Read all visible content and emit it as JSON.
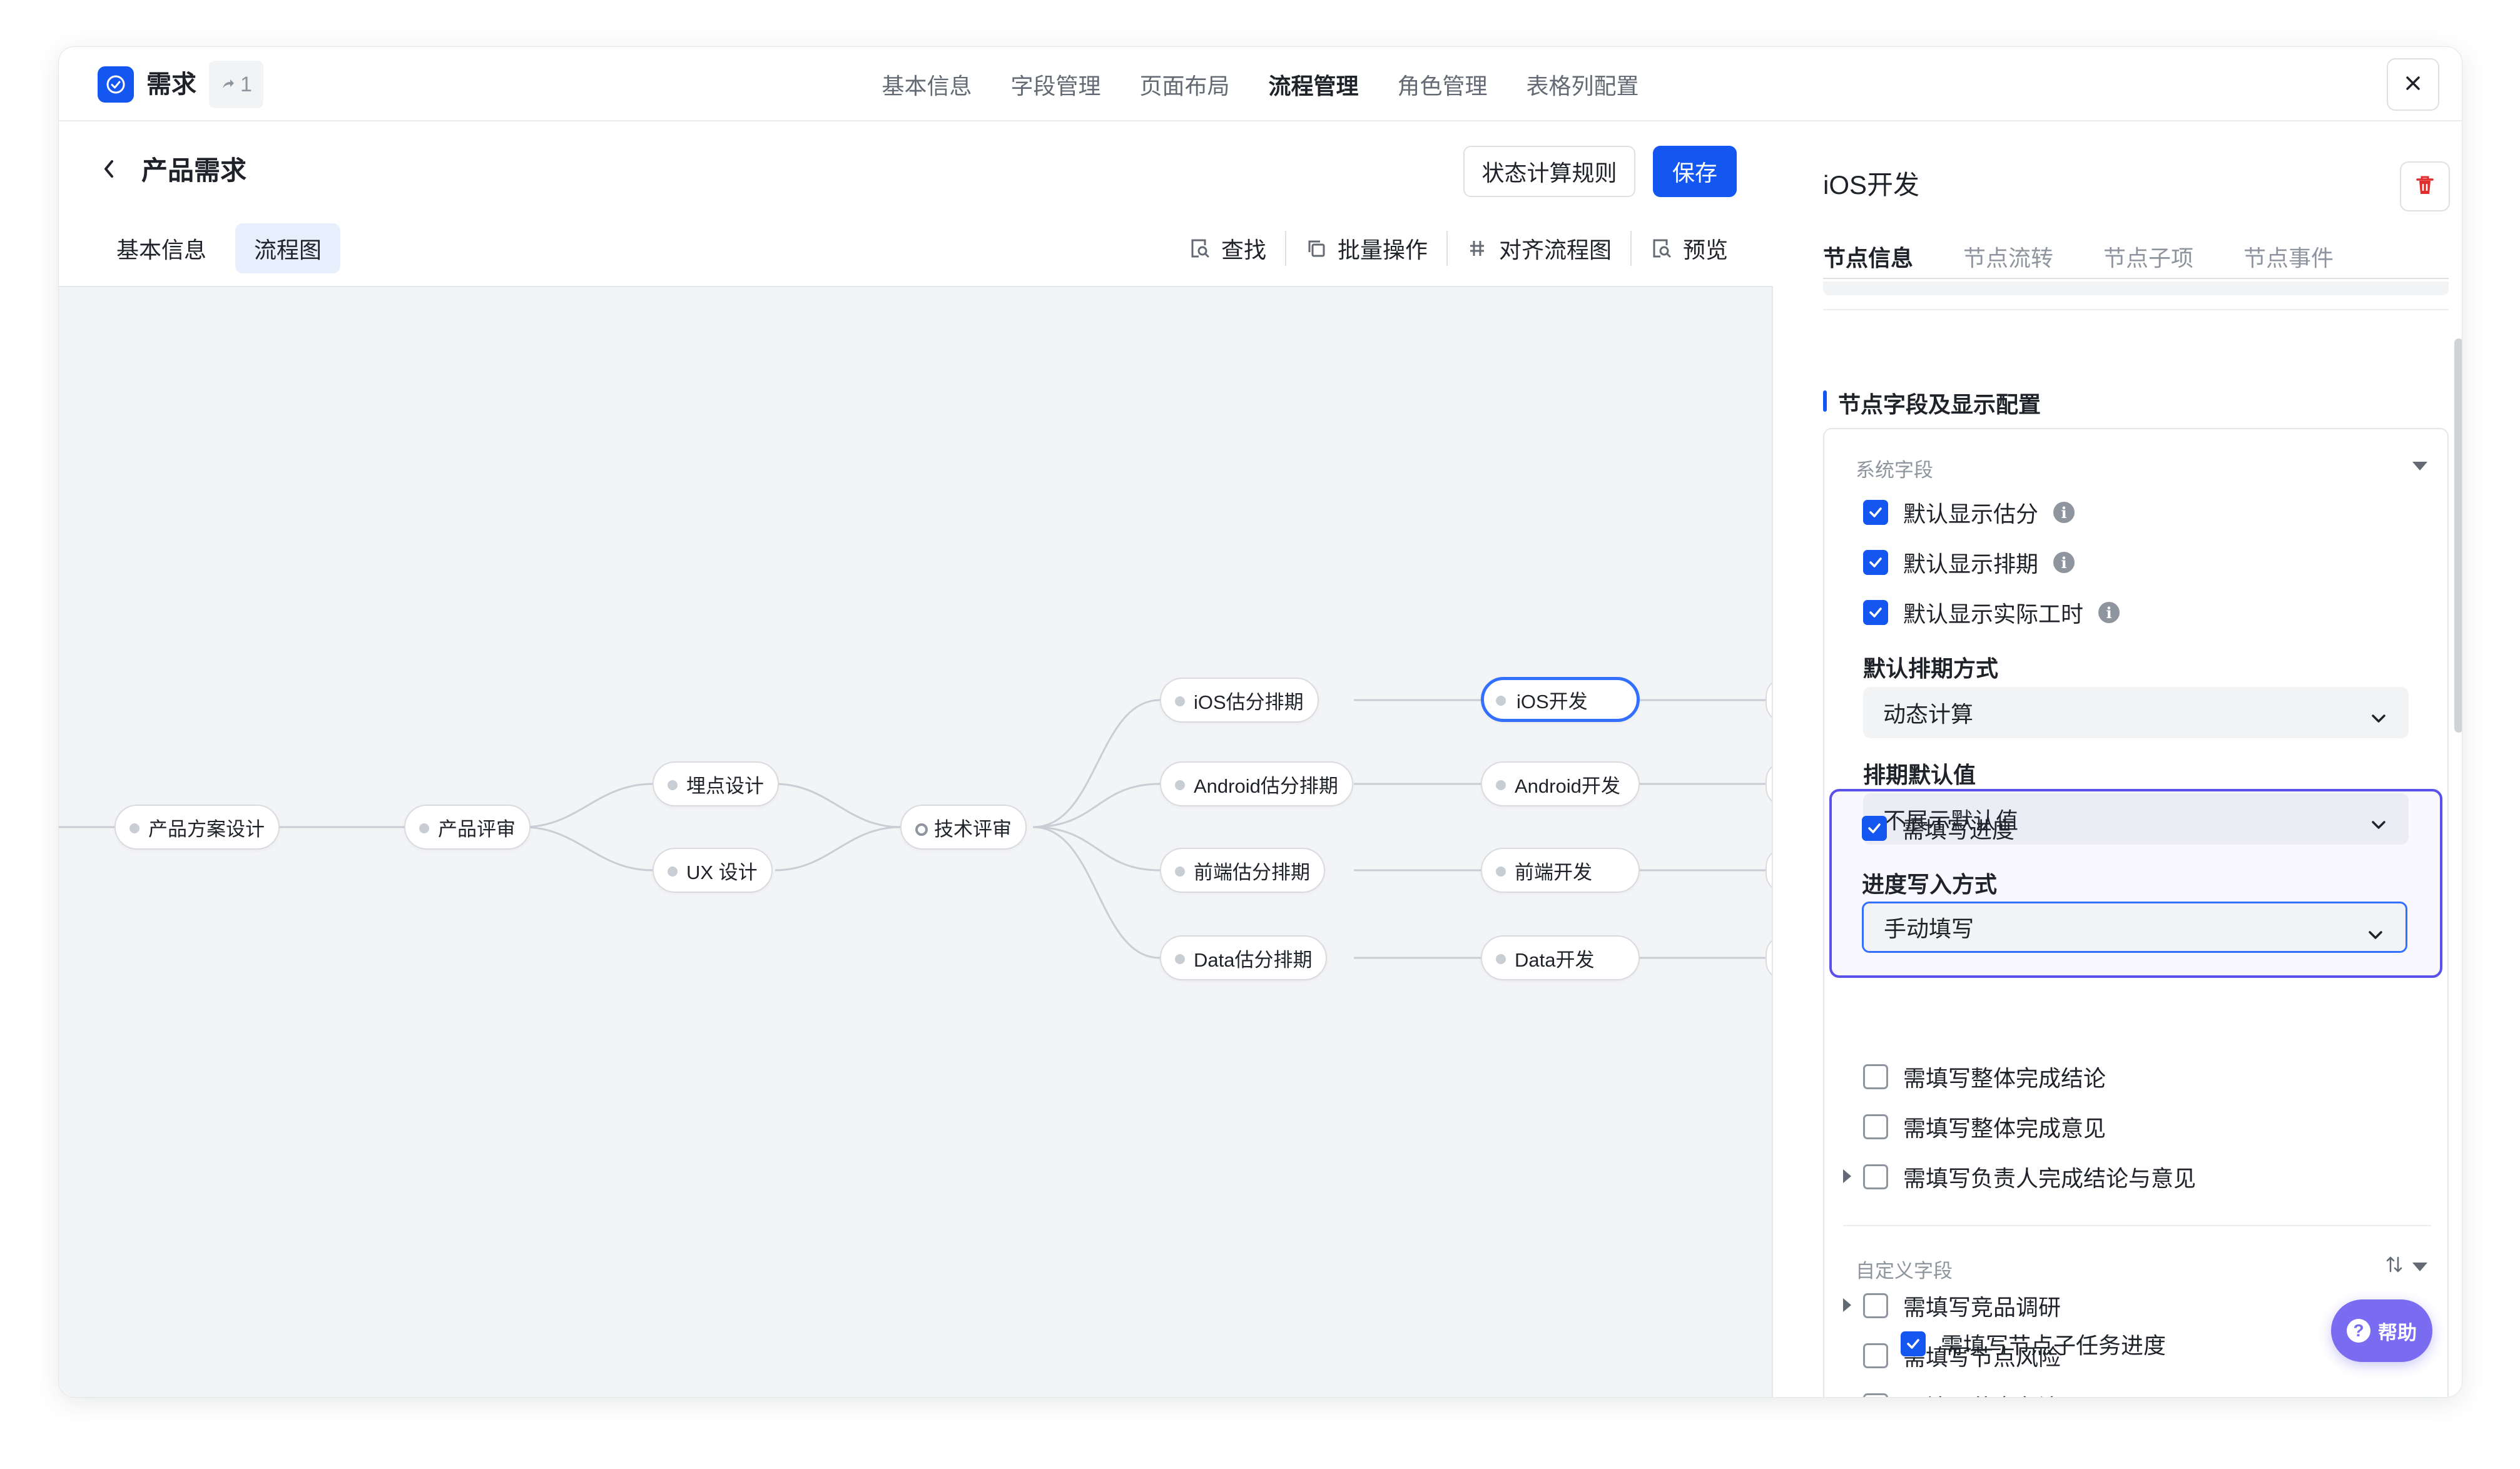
{
  "app": {
    "title": "需求",
    "share_count": "1"
  },
  "top_tabs": [
    {
      "label": "基本信息",
      "active": false
    },
    {
      "label": "字段管理",
      "active": false
    },
    {
      "label": "页面布局",
      "active": false
    },
    {
      "label": "流程管理",
      "active": true
    },
    {
      "label": "角色管理",
      "active": false
    },
    {
      "label": "表格列配置",
      "active": false
    }
  ],
  "page": {
    "title": "产品需求",
    "rule_button": "状态计算规则",
    "save_button": "保存",
    "sub_tabs": [
      "基本信息",
      "流程图"
    ],
    "tools": [
      "查找",
      "批量操作",
      "对齐流程图",
      "预览"
    ]
  },
  "flow": {
    "nodes": [
      "产品方案设计",
      "产品评审",
      "埋点设计",
      "UX 设计",
      "技术评审",
      "iOS估分排期",
      "Android估分排期",
      "前端估分排期",
      "Data估分排期",
      "iOS开发",
      "Android开发",
      "前端开发",
      "Data开发"
    ],
    "selected": "iOS开发"
  },
  "panel": {
    "title": "iOS开发",
    "tabs": [
      "节点信息",
      "节点流转",
      "节点子项",
      "节点事件"
    ],
    "section_title": "节点字段及显示配置",
    "system_group": "系统字段",
    "system_fields": [
      {
        "label": "默认显示估分",
        "checked": true,
        "info": true
      },
      {
        "label": "默认显示排期",
        "checked": true,
        "info": true
      },
      {
        "label": "默认显示实际工时",
        "checked": true,
        "info": true
      }
    ],
    "schedule_mode_label": "默认排期方式",
    "schedule_mode_value": "动态计算",
    "schedule_default_label": "排期默认值",
    "schedule_default_value": "不展示默认值",
    "progress_required": {
      "label": "需填写进度",
      "checked": true
    },
    "progress_mode_label": "进度写入方式",
    "progress_mode_value": "手动填写",
    "more_fields": [
      {
        "label": "需填写整体完成结论",
        "checked": false,
        "expandable": false
      },
      {
        "label": "需填写整体完成意见",
        "checked": false,
        "expandable": false
      },
      {
        "label": "需填写负责人完成结论与意见",
        "checked": false,
        "expandable": true
      }
    ],
    "custom_group": "自定义字段",
    "custom_fields": [
      {
        "label": "需填写竞品调研",
        "checked": false,
        "expandable": true
      },
      {
        "label": "需填写节点风险",
        "checked": false,
        "expandable": false
      },
      {
        "label": "需填写节点备注",
        "checked": false,
        "expandable": false
      },
      {
        "label": "需填写节点子任务进度",
        "checked": true,
        "expandable": false
      }
    ]
  },
  "help": {
    "label": "帮助"
  },
  "colors": {
    "accent": "#1456f0",
    "highlight": "#5b51e8",
    "help": "#7a6cf0",
    "delete": "#e02e2e"
  },
  "icons": [
    "check-circle-icon",
    "share-icon",
    "close-icon",
    "chevron-left-icon",
    "search-doc-icon",
    "copy-icon",
    "align-icon",
    "preview-icon",
    "trash-icon",
    "info-icon",
    "chevron-down-icon",
    "sort-icon",
    "help-icon"
  ]
}
